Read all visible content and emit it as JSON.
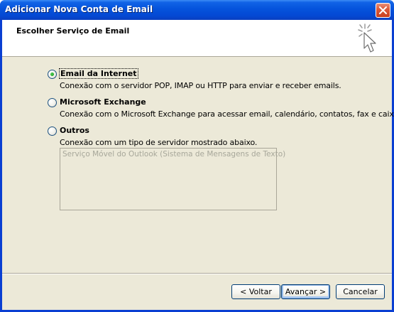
{
  "window": {
    "title": "Adicionar Nova Conta de Email"
  },
  "header": {
    "title": "Escolher Serviço de Email",
    "icon": "wizard-cursor-icon"
  },
  "options": [
    {
      "label": "Email da Internet",
      "description": "Conexão com o servidor POP, IMAP ou HTTP para enviar e receber emails.",
      "selected": true
    },
    {
      "label": "Microsoft Exchange",
      "description": "Conexão com o Microsoft Exchange para acessar email, calendário, contatos, fax e caixa postal.",
      "selected": false
    },
    {
      "label": "Outros",
      "description": "Conexão com um tipo de servidor mostrado abaixo.",
      "selected": false
    }
  ],
  "other_servers": {
    "items": [
      "Serviço Móvel do Outlook (Sistema de Mensagens de Texto)"
    ]
  },
  "buttons": {
    "back": "< Voltar",
    "next": "Avançar >",
    "cancel": "Cancelar"
  },
  "colors": {
    "titlebar": "#0553dc",
    "dialog_bg": "#ece9d8",
    "radio_selected": "#21a121"
  }
}
